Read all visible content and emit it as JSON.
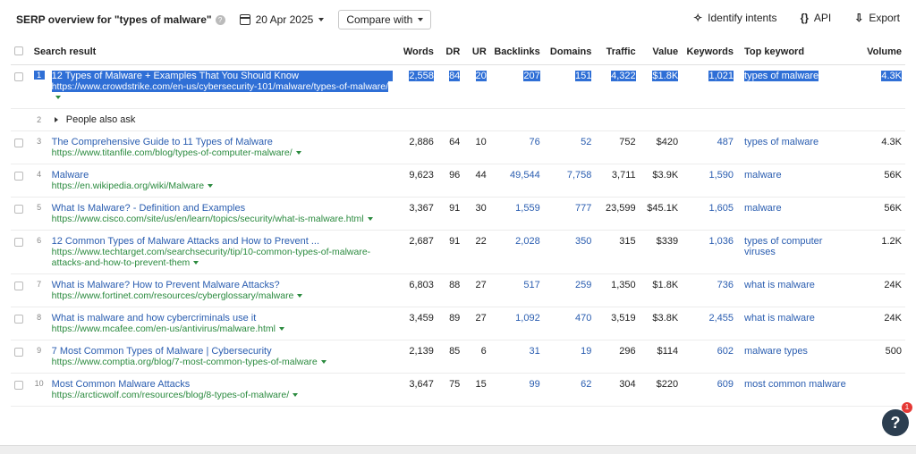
{
  "header": {
    "title": "SERP overview for \"types of malware\"",
    "date": "20 Apr 2025",
    "compare_label": "Compare with",
    "identify_intents": "Identify intents",
    "api": "API",
    "export": "Export"
  },
  "columns": [
    "Search result",
    "Words",
    "DR",
    "UR",
    "Backlinks",
    "Domains",
    "Traffic",
    "Value",
    "Keywords",
    "Top keyword",
    "Volume"
  ],
  "paa": {
    "pos": "2",
    "label": "People also ask"
  },
  "rows": [
    {
      "pos": "1",
      "title": "12 Types of Malware + Examples That You Should Know",
      "url": "https://www.crowdstrike.com/en-us/cybersecurity-101/malware/types-of-malware/",
      "words": "2,558",
      "dr": "84",
      "ur": "20",
      "backlinks": "207",
      "domains": "151",
      "traffic": "4,322",
      "value": "$1.8K",
      "keywords": "1,021",
      "top_keyword": "types of malware",
      "volume": "4.3K"
    },
    {
      "pos": "3",
      "title": "The Comprehensive Guide to 11 Types of Malware",
      "url": "https://www.titanfile.com/blog/types-of-computer-malware/",
      "words": "2,886",
      "dr": "64",
      "ur": "10",
      "backlinks": "76",
      "domains": "52",
      "traffic": "752",
      "value": "$420",
      "keywords": "487",
      "top_keyword": "types of malware",
      "volume": "4.3K"
    },
    {
      "pos": "4",
      "title": "Malware",
      "url": "https://en.wikipedia.org/wiki/Malware",
      "words": "9,623",
      "dr": "96",
      "ur": "44",
      "backlinks": "49,544",
      "domains": "7,758",
      "traffic": "3,711",
      "value": "$3.9K",
      "keywords": "1,590",
      "top_keyword": "malware",
      "volume": "56K"
    },
    {
      "pos": "5",
      "title": "What Is Malware? - Definition and Examples",
      "url": "https://www.cisco.com/site/us/en/learn/topics/security/what-is-malware.html",
      "words": "3,367",
      "dr": "91",
      "ur": "30",
      "backlinks": "1,559",
      "domains": "777",
      "traffic": "23,599",
      "value": "$45.1K",
      "keywords": "1,605",
      "top_keyword": "malware",
      "volume": "56K"
    },
    {
      "pos": "6",
      "title": "12 Common Types of Malware Attacks and How to Prevent ...",
      "url": "https://www.techtarget.com/searchsecurity/tip/10-common-types-of-malware-attacks-and-how-to-prevent-them",
      "words": "2,687",
      "dr": "91",
      "ur": "22",
      "backlinks": "2,028",
      "domains": "350",
      "traffic": "315",
      "value": "$339",
      "keywords": "1,036",
      "top_keyword": "types of computer viruses",
      "volume": "1.2K"
    },
    {
      "pos": "7",
      "title": "What is Malware? How to Prevent Malware Attacks?",
      "url": "https://www.fortinet.com/resources/cyberglossary/malware",
      "words": "6,803",
      "dr": "88",
      "ur": "27",
      "backlinks": "517",
      "domains": "259",
      "traffic": "1,350",
      "value": "$1.8K",
      "keywords": "736",
      "top_keyword": "what is malware",
      "volume": "24K"
    },
    {
      "pos": "8",
      "title": "What is malware and how cybercriminals use it",
      "url": "https://www.mcafee.com/en-us/antivirus/malware.html",
      "words": "3,459",
      "dr": "89",
      "ur": "27",
      "backlinks": "1,092",
      "domains": "470",
      "traffic": "3,519",
      "value": "$3.8K",
      "keywords": "2,455",
      "top_keyword": "what is malware",
      "volume": "24K"
    },
    {
      "pos": "9",
      "title": "7 Most Common Types of Malware | Cybersecurity",
      "url": "https://www.comptia.org/blog/7-most-common-types-of-malware",
      "words": "2,139",
      "dr": "85",
      "ur": "6",
      "backlinks": "31",
      "domains": "19",
      "traffic": "296",
      "value": "$114",
      "keywords": "602",
      "top_keyword": "malware types",
      "volume": "500"
    },
    {
      "pos": "10",
      "title": "Most Common Malware Attacks",
      "url": "https://arcticwolf.com/resources/blog/8-types-of-malware/",
      "words": "3,647",
      "dr": "75",
      "ur": "15",
      "backlinks": "99",
      "domains": "62",
      "traffic": "304",
      "value": "$220",
      "keywords": "609",
      "top_keyword": "most common malware",
      "volume": ""
    }
  ],
  "help": {
    "label": "?",
    "badge": "1"
  }
}
